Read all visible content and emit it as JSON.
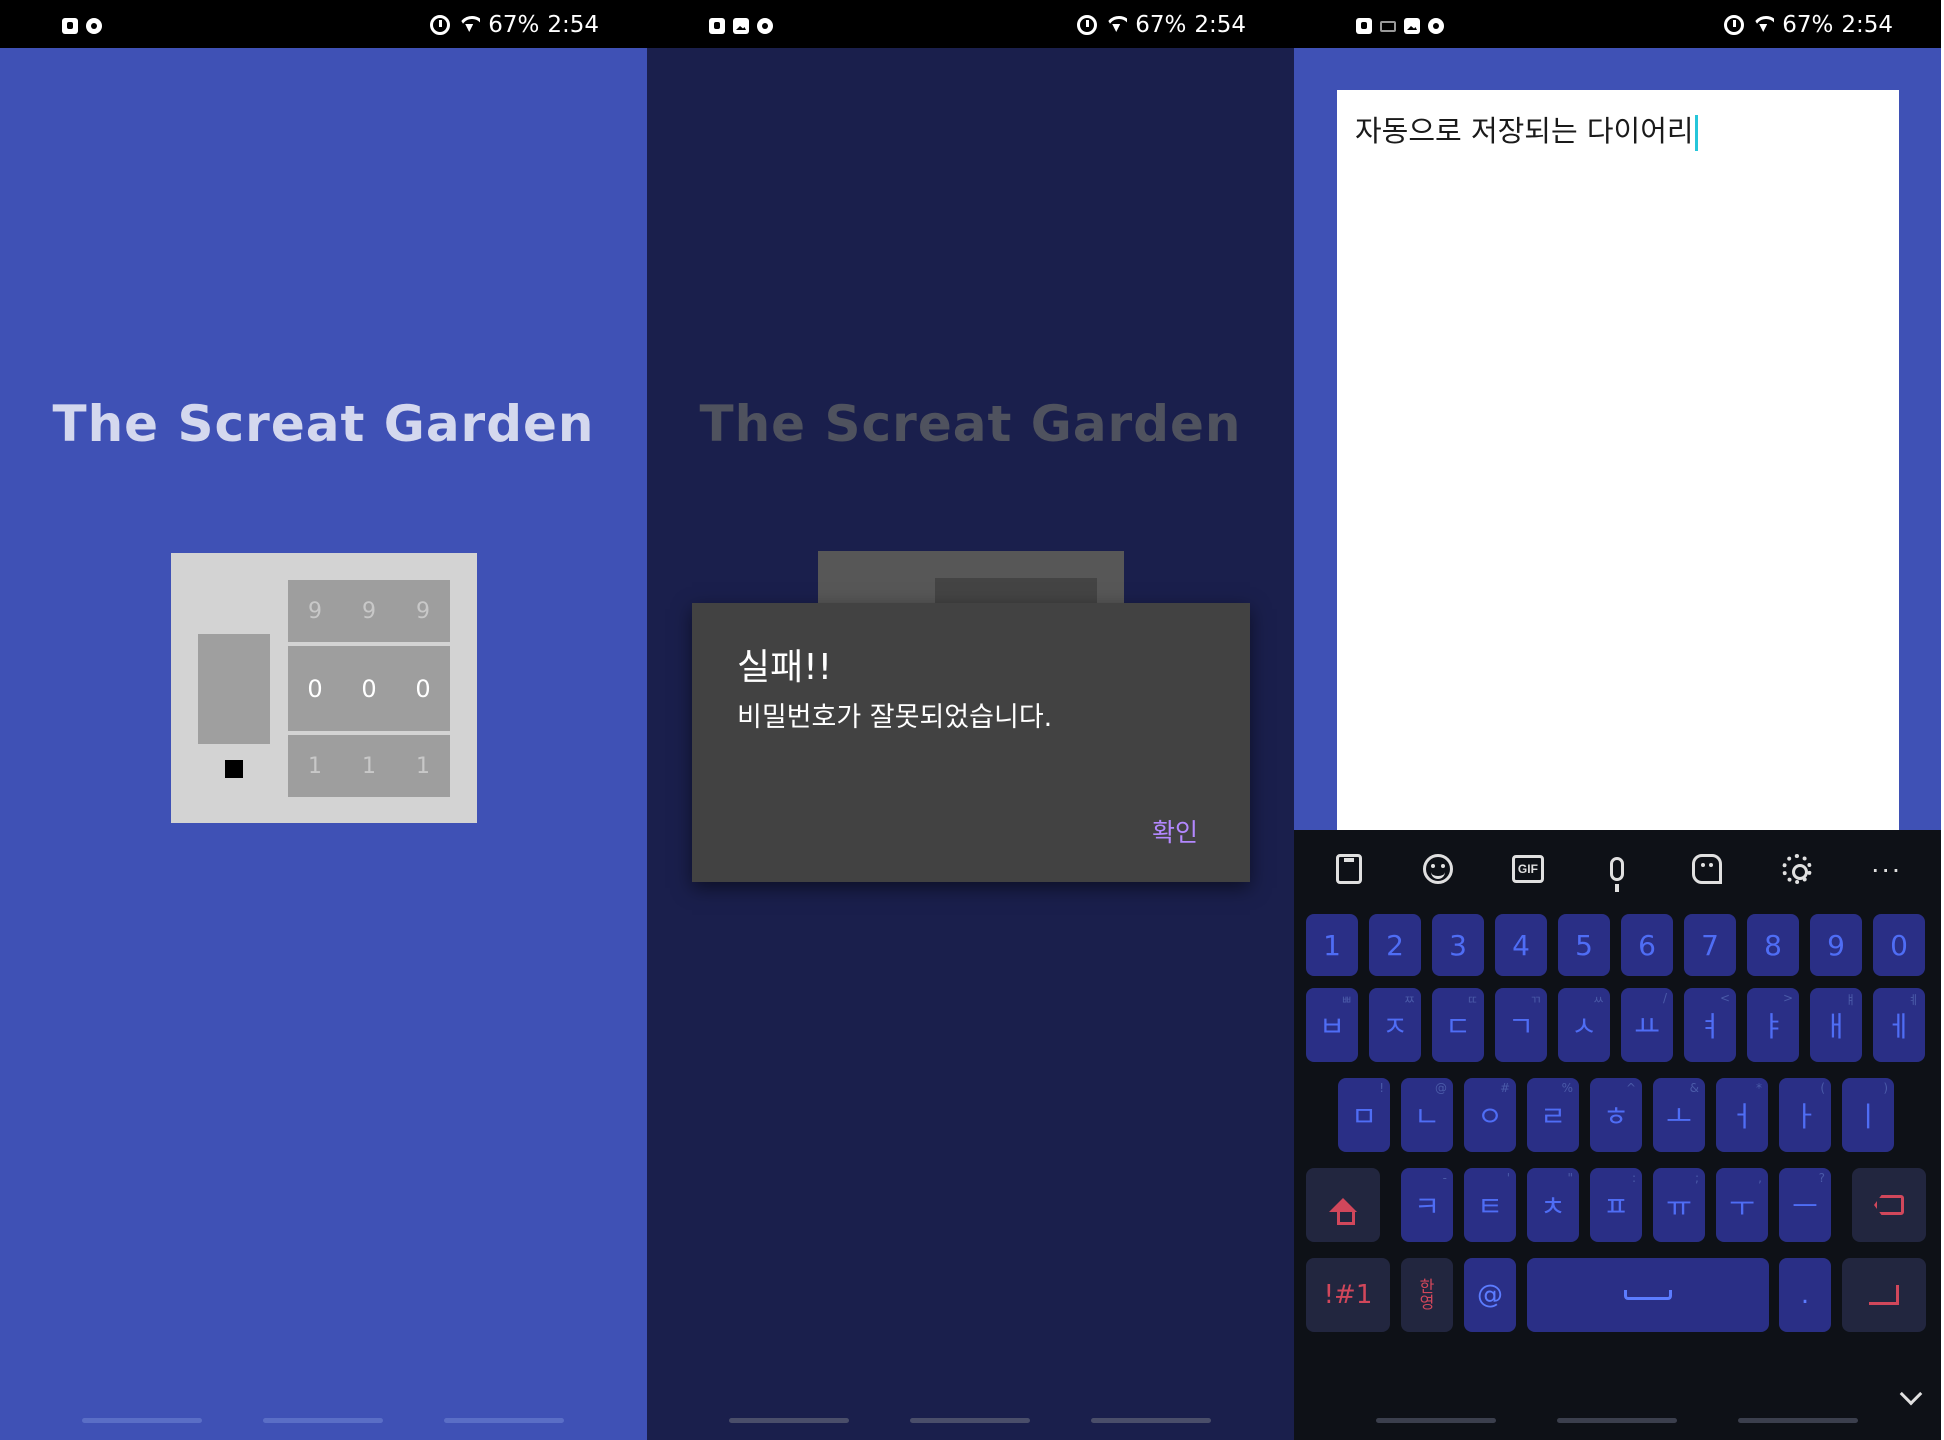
{
  "status_bar": {
    "battery": "67%",
    "time": "2:54"
  },
  "screen1": {
    "app_title": "The Screat Garden",
    "dial_rows": {
      "top": [
        "9",
        "9",
        "9"
      ],
      "current": [
        "0",
        "0",
        "0"
      ],
      "bottom": [
        "1",
        "1",
        "1"
      ]
    }
  },
  "screen2": {
    "app_title": "The Screat Garden",
    "dialog": {
      "title": "실패!!",
      "message": "비밀번호가 잘못되었습니다.",
      "confirm_label": "확인"
    }
  },
  "screen3": {
    "diary_text": "자동으로 저장되는 다이어리",
    "keyboard": {
      "toolbar": [
        "clipboard-icon",
        "emoji-icon",
        "gif-icon",
        "microphone-icon",
        "sticker-icon",
        "settings-icon",
        "more-icon"
      ],
      "gif_label": "GIF",
      "more_label": "···",
      "numbers": [
        "1",
        "2",
        "3",
        "4",
        "5",
        "6",
        "7",
        "8",
        "9",
        "0"
      ],
      "row1": [
        {
          "k": "ㅂ",
          "alt": "ㅃ"
        },
        {
          "k": "ㅈ",
          "alt": "ㅉ"
        },
        {
          "k": "ㄷ",
          "alt": "ㄸ"
        },
        {
          "k": "ㄱ",
          "alt": "ㄲ"
        },
        {
          "k": "ㅅ",
          "alt": "ㅆ"
        },
        {
          "k": "ㅛ",
          "alt": "/"
        },
        {
          "k": "ㅕ",
          "alt": "<"
        },
        {
          "k": "ㅑ",
          "alt": ">"
        },
        {
          "k": "ㅐ",
          "alt": "ㅒ"
        },
        {
          "k": "ㅔ",
          "alt": "ㅖ"
        }
      ],
      "row2": [
        {
          "k": "ㅁ",
          "alt": "!"
        },
        {
          "k": "ㄴ",
          "alt": "@"
        },
        {
          "k": "ㅇ",
          "alt": "#"
        },
        {
          "k": "ㄹ",
          "alt": "%"
        },
        {
          "k": "ㅎ",
          "alt": "^"
        },
        {
          "k": "ㅗ",
          "alt": "&"
        },
        {
          "k": "ㅓ",
          "alt": "*"
        },
        {
          "k": "ㅏ",
          "alt": "("
        },
        {
          "k": "ㅣ",
          "alt": ")"
        }
      ],
      "row3": [
        {
          "k": "ㅋ",
          "alt": "-"
        },
        {
          "k": "ㅌ",
          "alt": "'"
        },
        {
          "k": "ㅊ",
          "alt": "\""
        },
        {
          "k": "ㅍ",
          "alt": ":"
        },
        {
          "k": "ㅠ",
          "alt": ";"
        },
        {
          "k": "ㅜ",
          "alt": ","
        },
        {
          "k": "ㅡ",
          "alt": "?"
        }
      ],
      "symbols_label": "!#1",
      "lang_top": "한",
      "lang_bottom": "영",
      "at_label": "@",
      "period_label": "."
    }
  },
  "colors": {
    "primary": "#3f51b5",
    "dim_overlay": "#1a1f4c",
    "dialog_bg": "#424242",
    "dialog_accent": "#b388ff",
    "keyboard_bg": "#0e1117",
    "key_bg": "#2a2f86",
    "key_text": "#4f6df5",
    "func_key_text": "#d1475b",
    "text_cursor": "#26c6da"
  }
}
